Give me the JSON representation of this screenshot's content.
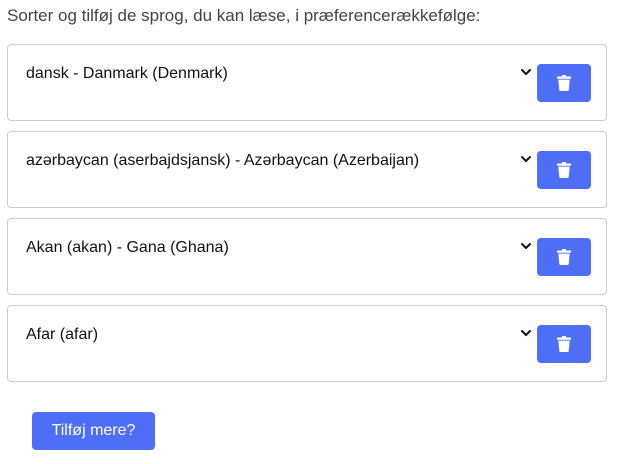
{
  "instruction": "Sorter og tilføj de sprog, du kan læse, i præferencerækkefølge:",
  "languages": [
    {
      "label": "dansk - Danmark (Denmark)"
    },
    {
      "label": "azərbaycan (aserbajdsjansk) - Azərbaycan (Azerbaijan)"
    },
    {
      "label": "Akan (akan) - Gana (Ghana)"
    },
    {
      "label": "Afar (afar)"
    }
  ],
  "add_more_label": "Tilføj mere?",
  "icons": {
    "dropdown": "chevron-down-icon",
    "delete": "trash-icon"
  },
  "colors": {
    "accent": "#4f6ef7",
    "border": "#cccccc",
    "instruction_text": "#444444"
  }
}
